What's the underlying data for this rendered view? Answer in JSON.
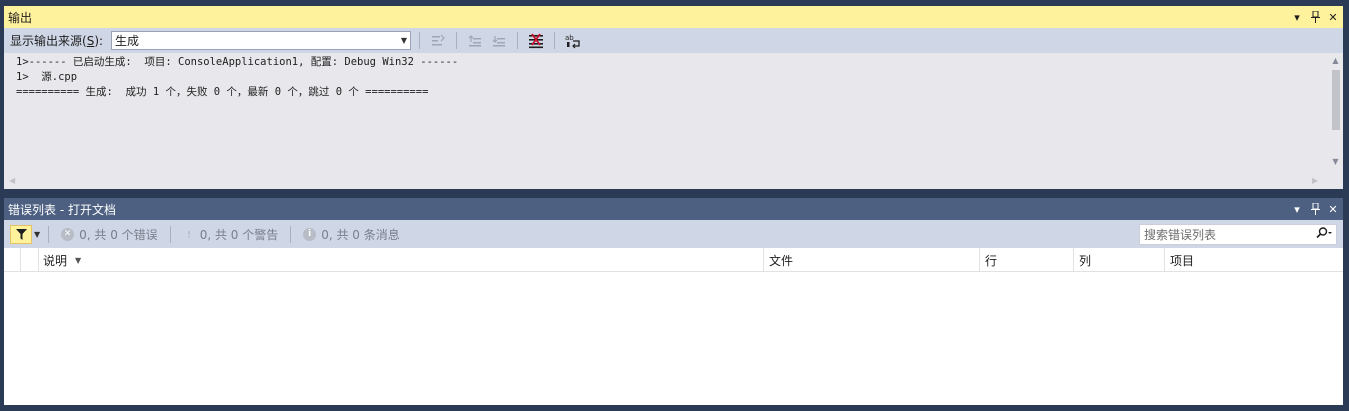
{
  "output_panel": {
    "title": "输出",
    "show_output_label_prefix": "显示输出来源(",
    "show_output_label_key": "S",
    "show_output_label_suffix": "):",
    "source_value": "生成",
    "lines": [
      "1>------ 已启动生成:  项目: ConsoleApplication1, 配置: Debug Win32 ------",
      "1>  源.cpp",
      "========== 生成:  成功 1 个，失败 0 个，最新 0 个，跳过 0 个 =========="
    ]
  },
  "error_panel": {
    "title": "错误列表 - 打开文档",
    "errors_label": "0, 共 0 个错误",
    "warnings_label": "0, 共 0 个警告",
    "messages_label": "0, 共 0 条消息",
    "search_placeholder": "搜索错误列表",
    "columns": [
      "说明",
      "文件",
      "行",
      "列",
      "项目"
    ]
  },
  "colors": {
    "active_title": "#fff29d",
    "inactive_title": "#4d6082",
    "toolbar_bg": "#cfd6e5",
    "frame_bg": "#2b3a55"
  },
  "icons": {
    "dropdown": "chevron-down-icon",
    "pin": "pin-icon",
    "close": "close-icon"
  }
}
